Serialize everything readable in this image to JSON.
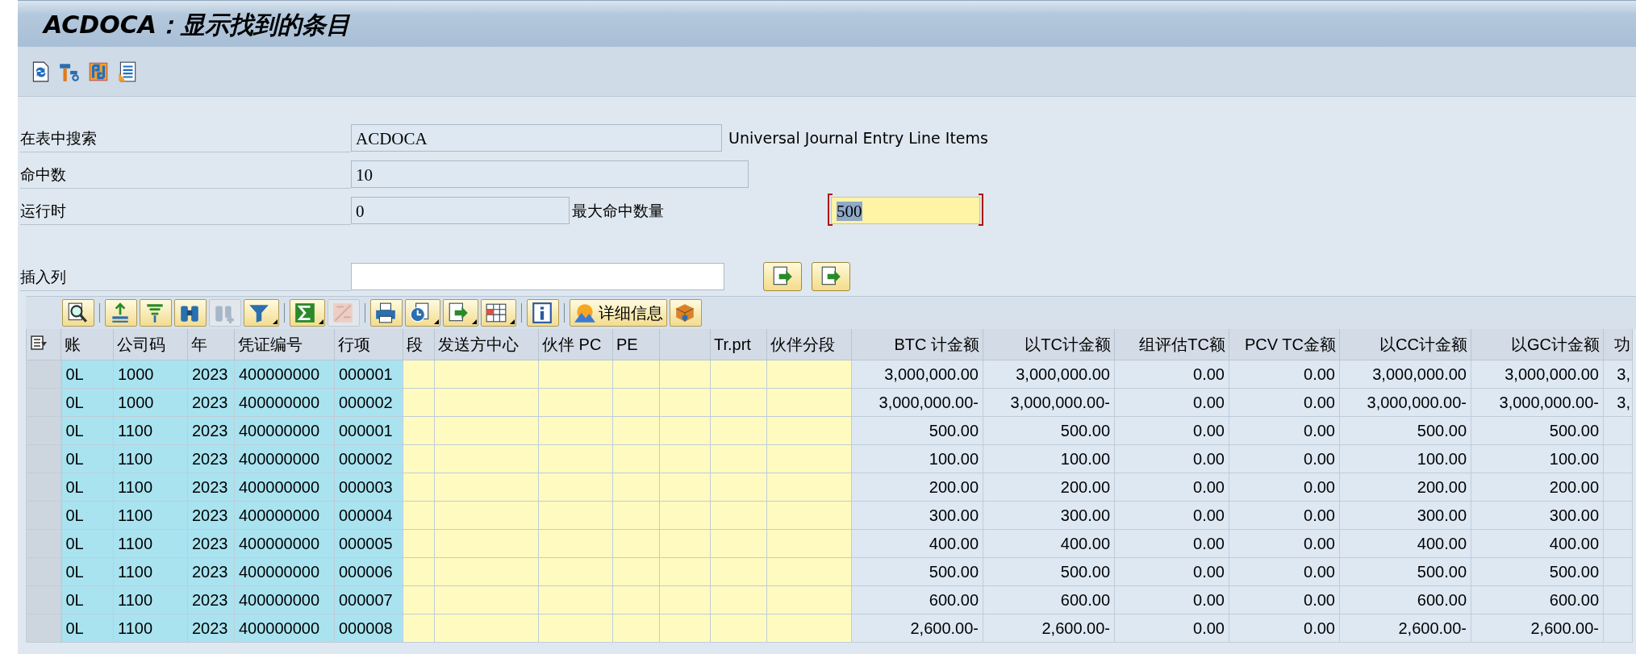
{
  "window": {
    "title": "ACDOCA：显示找到的条目"
  },
  "toolbar": {
    "buttons": [
      {
        "kind": "refresh"
      },
      {
        "kind": "tool"
      },
      {
        "kind": "bracket"
      },
      {
        "kind": "list"
      }
    ]
  },
  "form": {
    "table_label": "在表中搜索",
    "table_value": "ACDOCA",
    "table_description": "Universal Journal Entry Line Items",
    "hits_label": "命中数",
    "hits_value": "10",
    "runtime_label": "运行时",
    "runtime_value": "0",
    "max_hits_label": "最大命中数量",
    "max_hits_value": "500",
    "max_hits_focused": true,
    "insert_column_label": "插入列"
  },
  "alv_toolbar": {
    "buttons": [
      {
        "kind": "zoom",
        "disabled": false,
        "dropdown": false
      },
      {
        "kind": "sep"
      },
      {
        "kind": "sort_up",
        "disabled": false,
        "dropdown": false
      },
      {
        "kind": "sort_down",
        "disabled": false,
        "dropdown": false
      },
      {
        "kind": "find",
        "disabled": false,
        "dropdown": false
      },
      {
        "kind": "find_next",
        "disabled": true,
        "dropdown": false
      },
      {
        "kind": "filter",
        "disabled": false,
        "dropdown": true
      },
      {
        "kind": "sep"
      },
      {
        "kind": "sum",
        "disabled": false,
        "dropdown": true
      },
      {
        "kind": "subtotal",
        "disabled": true,
        "dropdown": false
      },
      {
        "kind": "sep"
      },
      {
        "kind": "print",
        "disabled": false,
        "dropdown": false
      },
      {
        "kind": "view",
        "disabled": false,
        "dropdown": true
      },
      {
        "kind": "export",
        "disabled": false,
        "dropdown": true
      },
      {
        "kind": "layout",
        "disabled": false,
        "dropdown": true
      },
      {
        "kind": "sep"
      },
      {
        "kind": "info",
        "disabled": false,
        "dropdown": false
      },
      {
        "kind": "sep"
      },
      {
        "kind": "details",
        "label": "详细信息",
        "disabled": false,
        "dropdown": false
      },
      {
        "kind": "package",
        "disabled": false,
        "dropdown": false
      }
    ]
  },
  "table": {
    "columns": [
      {
        "label": "账",
        "kind": "key"
      },
      {
        "label": "公司码",
        "kind": "key"
      },
      {
        "label": "年",
        "kind": "key"
      },
      {
        "label": "凭证编号",
        "kind": "key"
      },
      {
        "label": "行项",
        "kind": "key"
      },
      {
        "label": "段",
        "kind": "char"
      },
      {
        "label": "发送方中心",
        "kind": "char"
      },
      {
        "label": "伙伴 PC",
        "kind": "char"
      },
      {
        "label": "PE",
        "kind": "char"
      },
      {
        "kind": "char"
      },
      {
        "label": "Tr.prt",
        "kind": "char"
      },
      {
        "label": "伙伴分段",
        "kind": "char"
      },
      {
        "label": "BTC 计金额",
        "kind": "amount"
      },
      {
        "label": "以TC计金额",
        "kind": "amount"
      },
      {
        "label": "组评估TC额",
        "kind": "amount"
      },
      {
        "label": "PCV TC金额",
        "kind": "amount"
      },
      {
        "label": "以CC计金额",
        "kind": "amount"
      },
      {
        "label": "以GC计金额",
        "kind": "amount"
      },
      {
        "label": "功",
        "kind": "amount"
      }
    ],
    "rows": [
      {
        "key": [
          "0L",
          "1000",
          "2023",
          "400000000",
          "000001"
        ],
        "amounts": [
          "3,000,000.00",
          "3,000,000.00",
          "0.00",
          "0.00",
          "3,000,000.00",
          "3,000,000.00",
          "3,"
        ]
      },
      {
        "key": [
          "0L",
          "1000",
          "2023",
          "400000000",
          "000002"
        ],
        "amounts": [
          "3,000,000.00-",
          "3,000,000.00-",
          "0.00",
          "0.00",
          "3,000,000.00-",
          "3,000,000.00-",
          "3,"
        ]
      },
      {
        "key": [
          "0L",
          "1100",
          "2023",
          "400000000",
          "000001"
        ],
        "amounts": [
          "500.00",
          "500.00",
          "0.00",
          "0.00",
          "500.00",
          "500.00"
        ]
      },
      {
        "key": [
          "0L",
          "1100",
          "2023",
          "400000000",
          "000002"
        ],
        "amounts": [
          "100.00",
          "100.00",
          "0.00",
          "0.00",
          "100.00",
          "100.00"
        ]
      },
      {
        "key": [
          "0L",
          "1100",
          "2023",
          "400000000",
          "000003"
        ],
        "amounts": [
          "200.00",
          "200.00",
          "0.00",
          "0.00",
          "200.00",
          "200.00"
        ]
      },
      {
        "key": [
          "0L",
          "1100",
          "2023",
          "400000000",
          "000004"
        ],
        "amounts": [
          "300.00",
          "300.00",
          "0.00",
          "0.00",
          "300.00",
          "300.00"
        ]
      },
      {
        "key": [
          "0L",
          "1100",
          "2023",
          "400000000",
          "000005"
        ],
        "amounts": [
          "400.00",
          "400.00",
          "0.00",
          "0.00",
          "400.00",
          "400.00"
        ]
      },
      {
        "key": [
          "0L",
          "1100",
          "2023",
          "400000000",
          "000006"
        ],
        "amounts": [
          "500.00",
          "500.00",
          "0.00",
          "0.00",
          "500.00",
          "500.00"
        ]
      },
      {
        "key": [
          "0L",
          "1100",
          "2023",
          "400000000",
          "000007"
        ],
        "amounts": [
          "600.00",
          "600.00",
          "0.00",
          "0.00",
          "600.00",
          "600.00"
        ]
      },
      {
        "key": [
          "0L",
          "1100",
          "2023",
          "400000000",
          "000008"
        ],
        "amounts": [
          "2,600.00-",
          "2,600.00-",
          "0.00",
          "0.00",
          "2,600.00-",
          "2,600.00-"
        ]
      }
    ]
  }
}
